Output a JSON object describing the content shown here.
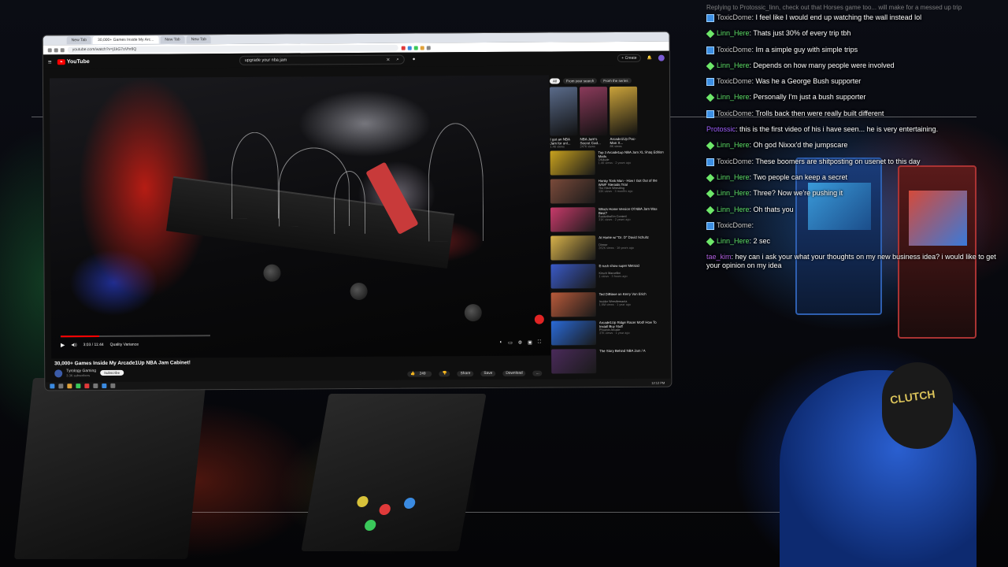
{
  "browser": {
    "tabs": [
      "New Tab",
      "30,000+ Games Inside My Arc...",
      "New Tab",
      "New Tab"
    ],
    "url": "youtube.com/watch?v=j1kG7oVhr8Q",
    "taskbar_clock": "12:12 PM"
  },
  "youtube": {
    "logo_text": "YouTube",
    "search_query": "upgrade your nba jam",
    "create_label": "+ Create",
    "player": {
      "time": "3:03 / 11:44",
      "quality_label": "Quality Variance",
      "progress_fraction": 0.26
    },
    "video": {
      "title": "30,000+ Games Inside My Arcade1Up NBA Jam Cabinet!",
      "channel": "Tyrology Gaming",
      "subscribers": "3.3K subscribers",
      "subscribe_label": "Subscribe",
      "likes": "249",
      "share_label": "Share",
      "save_label": "Save",
      "download_label": "Download",
      "more_label": "..."
    },
    "chips": [
      "All",
      "From your search",
      "From the series"
    ],
    "top_recommendations": [
      {
        "title": "I got an NBA Jam for onl...",
        "views": "1.4K views",
        "color": "#5a6b8a"
      },
      {
        "title": "NBA Jam's Secret Cod...",
        "views": "247K views",
        "color": "#8a3a5a"
      },
      {
        "title": "Arcade1Up Pac-Man X...",
        "views": "8K views",
        "color": "#caa23a"
      }
    ],
    "recommendations": [
      {
        "title": "Top 3 Arcade1up NBA Jam XL Shaq Edition Mods",
        "channel": "OKdude",
        "views": "1.4K views · 2 years ago",
        "color": "#c9a21e"
      },
      {
        "title": "Honky Tonk Man - How I Got Out of the WWF Steroids Trial",
        "channel": "The Hitch Wrestling",
        "views": "33K views · 3 months ago",
        "color": "#7a4a3a"
      },
      {
        "title": "Which Home Version Of NBA Jam Was Best?",
        "channel": "Basketball in Context",
        "views": "31K views · 2 years ago",
        "color": "#c83a6a"
      },
      {
        "title": "At Home w/ \"Dr. D\" David Schultz",
        "channel": "Dinner",
        "views": "262K views · 16 years ago",
        "color": "#d8b24a"
      },
      {
        "title": "E-rush show super Metroid",
        "channel": "Kirsch Marcellini",
        "views": "1 views · 3 hours ago",
        "color": "#3a5ac8"
      },
      {
        "title": "Ted DiBiase on Kerry Von Erich",
        "channel": "Insider Wrestlemania",
        "views": "1.6M views · 1 year ago",
        "color": "#b85a3a"
      },
      {
        "title": "Arcade1Up Ridge Racer Mod! How To Install Buy Stuff",
        "channel": "Phoenix Arcade",
        "views": "37K views · 1 year ago",
        "color": "#2a6ad8"
      },
      {
        "title": "The Story Behind NBA Jam / A",
        "channel": "",
        "views": "",
        "color": "#4a2a5a"
      }
    ]
  },
  "chat": {
    "reply_context": "Replying to Protossic_linn, check out that Horses game too... will make for a messed up trip",
    "messages": [
      {
        "user": "ToxicDome",
        "text": "I feel like I would end up watching the wall instead lol",
        "user_color": "#c8c8c8",
        "badge": "square"
      },
      {
        "user": "Linn_Here",
        "text": "Thats just 30% of every trip tbh",
        "user_color": "#5ee06a",
        "badge": "diamond"
      },
      {
        "user": "ToxicDome",
        "text": "Im a simple guy with simple trips",
        "user_color": "#c8c8c8",
        "badge": "square"
      },
      {
        "user": "Linn_Here",
        "text": "Depends on how many people were involved",
        "user_color": "#5ee06a",
        "badge": "diamond"
      },
      {
        "user": "ToxicDome",
        "text": "Was he a George Bush supporter",
        "user_color": "#c8c8c8",
        "badge": "square"
      },
      {
        "user": "Linn_Here",
        "text": "Personally I'm just a bush supporter",
        "user_color": "#5ee06a",
        "badge": "diamond"
      },
      {
        "user": "ToxicDome",
        "text": "Trolls back then were really built different",
        "user_color": "#c8c8c8",
        "badge": "square"
      },
      {
        "user": "Protossic",
        "text": "this is the first video of his i have seen... he is very entertaining.",
        "user_color": "#a060ff",
        "badge": "none"
      },
      {
        "user": "Linn_Here",
        "text": "Oh god Nixxx'd the jumpscare",
        "user_color": "#5ee06a",
        "badge": "diamond"
      },
      {
        "user": "ToxicDome",
        "text": "These boomers are shitposting on usenet to this day",
        "user_color": "#c8c8c8",
        "badge": "square"
      },
      {
        "user": "Linn_Here",
        "text": "Two people can keep a secret",
        "user_color": "#5ee06a",
        "badge": "diamond"
      },
      {
        "user": "Linn_Here",
        "text": "Three? Now we're pushing it",
        "user_color": "#5ee06a",
        "badge": "diamond"
      },
      {
        "user": "Linn_Here",
        "text": "Oh thats you",
        "user_color": "#5ee06a",
        "badge": "diamond"
      },
      {
        "user": "ToxicDome",
        "text": "",
        "user_color": "#c8c8c8",
        "badge": "square"
      },
      {
        "user": "Linn_Here",
        "text": "2 sec",
        "user_color": "#5ee06a",
        "badge": "diamond"
      },
      {
        "user": "tae_kim",
        "text": "hey can i ask your what your thoughts on my new business idea? i would like to get your opinion on my idea",
        "user_color": "#b060e0",
        "badge": "none"
      }
    ]
  },
  "scene": {
    "cap_text": "CLUTCH"
  }
}
